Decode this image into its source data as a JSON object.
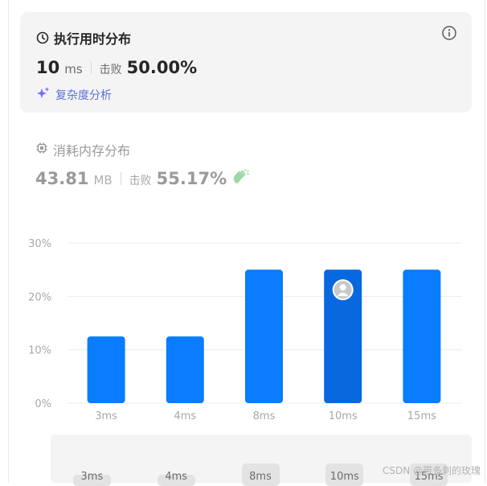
{
  "runtime": {
    "title": "执行用时分布",
    "value": "10",
    "unit": "ms",
    "beat_label": "击败",
    "beat_value": "50.00%",
    "complexity_link": "复杂度分析",
    "info_icon": "info-icon",
    "clock_icon": "clock-icon",
    "sparkle_icon": "sparkle-icon"
  },
  "memory": {
    "title": "消耗内存分布",
    "value": "43.81",
    "unit": "MB",
    "beat_label": "击败",
    "beat_value": "55.17%",
    "chip_icon": "chip-icon",
    "clap_icon": "clap-icon"
  },
  "chart_data": {
    "type": "bar",
    "categories": [
      "3ms",
      "4ms",
      "8ms",
      "10ms",
      "15ms"
    ],
    "values": [
      12.5,
      12.5,
      25,
      25,
      25
    ],
    "ylim": [
      0,
      30
    ],
    "yticks": [
      "0%",
      "10%",
      "20%",
      "30%"
    ],
    "highlight_index": 3,
    "grid": true,
    "bar_color": "#0a7cff",
    "highlight_color": "#0868e0"
  },
  "slider": {
    "labels": [
      "3ms",
      "4ms",
      "8ms",
      "10ms",
      "15ms"
    ],
    "levels": [
      0.125,
      0.125,
      0.25,
      0.25,
      0.25
    ]
  },
  "watermark": "CSDN @带多刺的玫瑰"
}
